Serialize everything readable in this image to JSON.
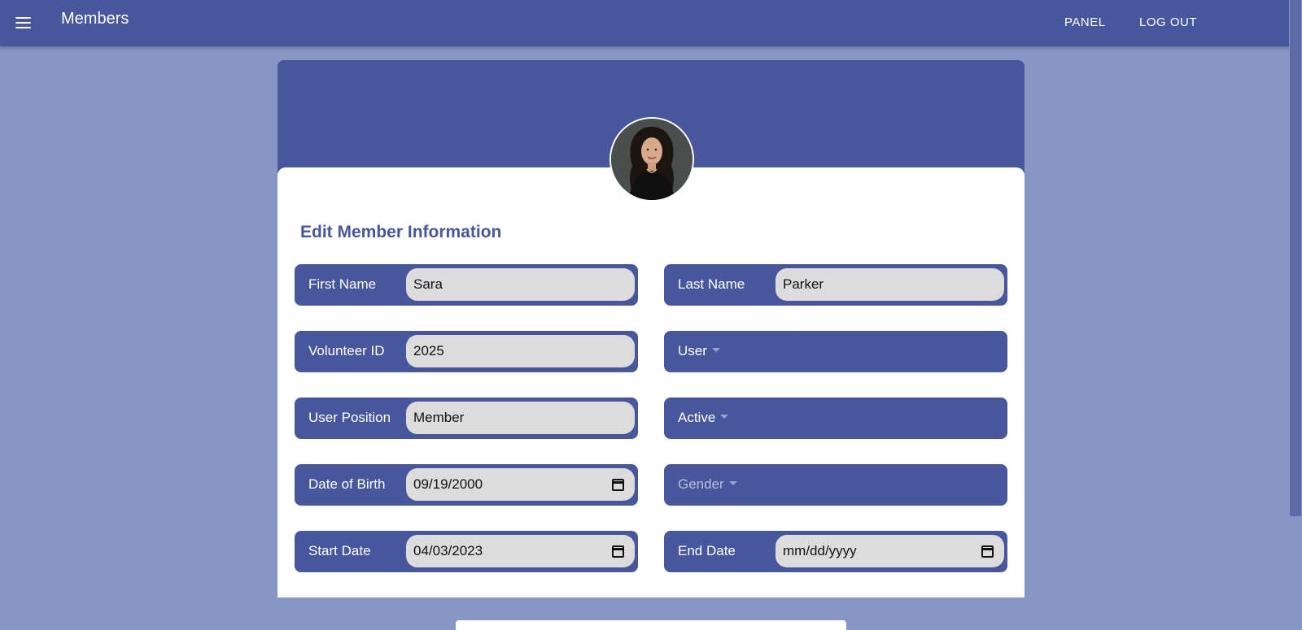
{
  "appbar": {
    "title": "Members",
    "nav": [
      "PANEL",
      "LOG OUT"
    ]
  },
  "form": {
    "title": "Edit Member Information",
    "first_name": {
      "label": "First Name",
      "value": "Sara"
    },
    "last_name": {
      "label": "Last Name",
      "value": "Parker"
    },
    "volunteer_id": {
      "label": "Volunteer ID",
      "value": "2025"
    },
    "user_select": {
      "label": "User"
    },
    "user_position": {
      "label": "User Position",
      "value": "Member"
    },
    "active_select": {
      "label": "Active"
    },
    "dob": {
      "label": "Date of Birth",
      "value": "09/19/2000"
    },
    "gender_select": {
      "label": "Gender"
    },
    "start_date": {
      "label": "Start Date",
      "value": "04/03/2023"
    },
    "end_date": {
      "label": "End Date",
      "placeholder": "mm/dd/yyyy"
    }
  },
  "colors": {
    "primary": "#48579c",
    "background": "#8794c6",
    "input": "#dcdcdc"
  },
  "icons": [
    "menu-icon",
    "calendar-icon",
    "caret-down-icon"
  ]
}
